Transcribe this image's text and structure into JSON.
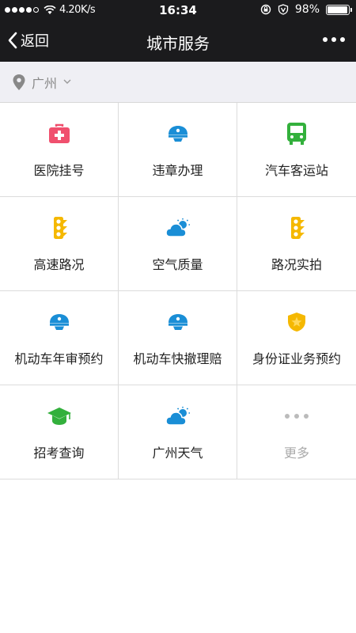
{
  "status_bar": {
    "speed": "4.20K/s",
    "time": "16:34",
    "battery": "98%",
    "battery_level": 0.98
  },
  "navbar": {
    "back_label": "返回",
    "title": "城市服务"
  },
  "location": {
    "city": "广州"
  },
  "services": [
    {
      "label": "医院挂号",
      "icon": "medical-kit-icon",
      "color": "#f0506e"
    },
    {
      "label": "违章办理",
      "icon": "police-cap-icon",
      "color": "#1a8ed6"
    },
    {
      "label": "汽车客运站",
      "icon": "bus-icon",
      "color": "#33b03c"
    },
    {
      "label": "高速路况",
      "icon": "traffic-light-icon",
      "color": "#f5b800"
    },
    {
      "label": "空气质量",
      "icon": "cloud-sun-icon",
      "color": "#1a8ed6"
    },
    {
      "label": "路况实拍",
      "icon": "traffic-light-icon",
      "color": "#f5b800"
    },
    {
      "label": "机动车年审预约",
      "icon": "police-cap-icon",
      "color": "#1a8ed6"
    },
    {
      "label": "机动车快撤理赔",
      "icon": "police-cap-icon",
      "color": "#1a8ed6"
    },
    {
      "label": "身份证业务预约",
      "icon": "police-badge-icon",
      "color": "#f5b800"
    },
    {
      "label": "招考查询",
      "icon": "graduation-cap-icon",
      "color": "#33b03c"
    },
    {
      "label": "广州天气",
      "icon": "cloud-sun-icon",
      "color": "#1a8ed6"
    },
    {
      "label": "更多",
      "icon": "more-dots-icon",
      "color": "#bbbbbb"
    }
  ]
}
